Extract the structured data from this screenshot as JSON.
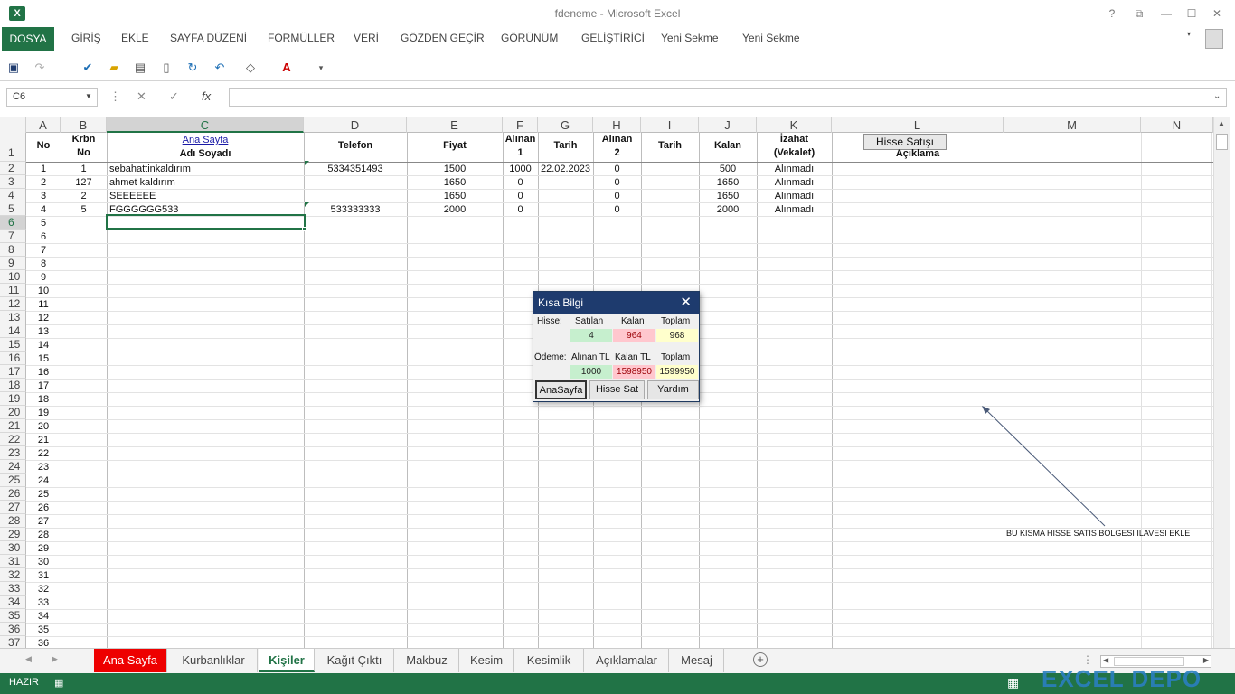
{
  "window": {
    "title": "fdeneme - Microsoft Excel",
    "help": "?",
    "restore": "⧉",
    "minimize": "—",
    "maximize": "☐",
    "close": "✕"
  },
  "ribbon": {
    "file_tab": "DOSYA",
    "tabs": [
      "GİRİŞ",
      "EKLE",
      "SAYFA DÜZENİ",
      "FORMÜLLER",
      "VERİ",
      "GÖZDEN GEÇİR",
      "GÖRÜNÜM",
      "GELİŞTİRİCİ",
      "Yeni Sekme",
      "Yeni Sekme"
    ]
  },
  "formula_bar": {
    "name_box": "C6",
    "fx": "fx",
    "value": ""
  },
  "columns": [
    "A",
    "B",
    "C",
    "D",
    "E",
    "F",
    "G",
    "H",
    "I",
    "J",
    "K",
    "L",
    "M",
    "N"
  ],
  "header": {
    "no": "No",
    "krbn_no_1": "Krbn",
    "krbn_no_2": "No",
    "ana_sayfa_link": "Ana Sayfa",
    "adi_soyadi": "Adı Soyadı",
    "telefon": "Telefon",
    "fiyat": "Fiyat",
    "alinan1_a": "Alınan",
    "alinan1_b": "1",
    "tarih1": "Tarih",
    "alinan2_a": "Alınan",
    "alinan2_b": "2",
    "tarih2": "Tarih",
    "kalan": "Kalan",
    "izahat_a": "İzahat",
    "izahat_b": "(Vekalet)",
    "hisse_button": "Hisse Satışı",
    "aciklama": "Açıklama"
  },
  "rows": [
    {
      "no": "1",
      "krbn": "1",
      "name": "sebahattinkaldırım",
      "tel": "5334351493",
      "fiyat": "1500",
      "alinan1": "1000",
      "tarih1": "22.02.2023",
      "alinan2": "0",
      "kalan": "500",
      "izahat": "Alınmadı"
    },
    {
      "no": "2",
      "krbn": "127",
      "name": "ahmet kaldırım",
      "tel": "",
      "fiyat": "1650",
      "alinan1": "0",
      "tarih1": "",
      "alinan2": "0",
      "kalan": "1650",
      "izahat": "Alınmadı"
    },
    {
      "no": "3",
      "krbn": "2",
      "name": "SEEEEEE",
      "tel": "",
      "fiyat": "1650",
      "alinan1": "0",
      "tarih1": "",
      "alinan2": "0",
      "kalan": "1650",
      "izahat": "Alınmadı"
    },
    {
      "no": "4",
      "krbn": "5",
      "name": "FGGGGGG533",
      "tel": "533333333",
      "fiyat": "2000",
      "alinan1": "0",
      "tarih1": "",
      "alinan2": "0",
      "kalan": "2000",
      "izahat": "Alınmadı"
    }
  ],
  "row_numbers": [
    "1",
    "2",
    "3",
    "4",
    "5",
    "6",
    "7",
    "8",
    "9",
    "10",
    "11",
    "12",
    "13",
    "14",
    "15",
    "16",
    "17",
    "18",
    "19",
    "20",
    "21",
    "22",
    "23",
    "24",
    "25",
    "26",
    "27",
    "28",
    "29",
    "30",
    "31",
    "32",
    "33",
    "34",
    "35",
    "36",
    "37"
  ],
  "a_column_numbers": [
    "5",
    "6",
    "7",
    "8",
    "9",
    "10",
    "11",
    "12",
    "13",
    "14",
    "15",
    "16",
    "17",
    "18",
    "19",
    "20",
    "21",
    "22",
    "23",
    "24",
    "25",
    "26",
    "27",
    "28",
    "29",
    "30",
    "31",
    "32",
    "33",
    "34",
    "35",
    "36"
  ],
  "note": "BU KISMA HISSE SATIS BOLGESI ILAVESI EKLE",
  "dialog": {
    "title": "Kısa Bilgi",
    "hisse_label": "Hisse:",
    "satilan_label": "Satılan",
    "kalan_label": "Kalan",
    "toplam_label": "Toplam",
    "satilan": "4",
    "kalan": "964",
    "toplam": "968",
    "odeme_label": "Ödeme:",
    "alinan_tl_label": "Alınan TL",
    "kalan_tl_label": "Kalan TL",
    "toplam2_label": "Toplam",
    "alinan_tl": "1000",
    "kalan_tl": "1598950",
    "toplam_tl": "1599950",
    "btn_anasayfa": "AnaSayfa",
    "btn_hisse_sat": "Hisse Sat",
    "btn_yardim": "Yardım",
    "close": "✕"
  },
  "sheets": [
    "Ana Sayfa",
    "Kurbanlıklar",
    "Kişiler",
    "Kağıt Çıktı",
    "Makbuz",
    "Kesim",
    "Kesimlik",
    "Açıklamalar",
    "Mesaj"
  ],
  "status": {
    "ready": "HAZIR"
  },
  "watermark": "EXCEL DEPO",
  "colors": {
    "excel_green": "#217346",
    "title_blue": "#1e3b6e",
    "green_fill": "#c6efce",
    "red_fill": "#ffc7ce",
    "yellow_fill": "#ffffcc"
  }
}
